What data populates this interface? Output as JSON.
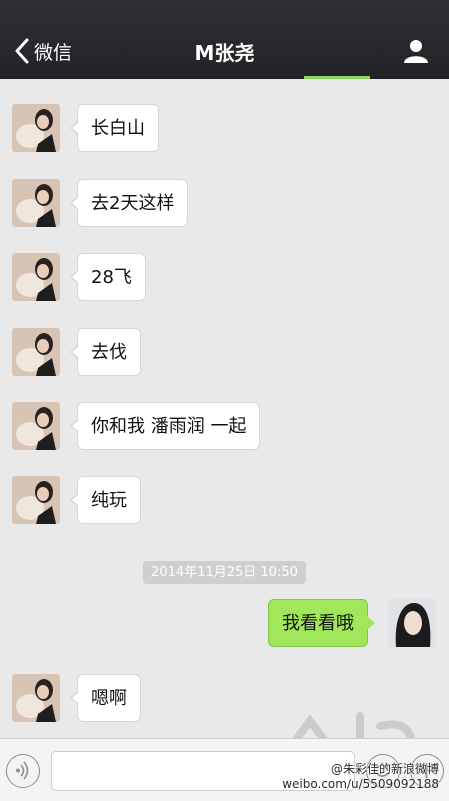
{
  "nav": {
    "back_label": "微信",
    "title": "M张尧"
  },
  "messages": [
    {
      "side": "in",
      "text": "长白山"
    },
    {
      "side": "in",
      "text": "去2天这样"
    },
    {
      "side": "in",
      "text": "28飞"
    },
    {
      "side": "in",
      "text": "去伐"
    },
    {
      "side": "in",
      "text": "你和我 潘雨润 一起"
    },
    {
      "side": "in",
      "text": "纯玩"
    },
    {
      "side": "out",
      "text": "我看看哦"
    },
    {
      "side": "in",
      "text": "嗯啊"
    }
  ],
  "timestamp": "2014年11月25日 10:50",
  "input": {
    "value": ""
  },
  "watermark": {
    "line1": "@朱彩佳的新浪微博",
    "line2": "weibo.com/u/5509092188"
  },
  "colors": {
    "nav_bg": "#2a2b2f",
    "chat_bg": "#e9e9e9",
    "outgoing_bubble": "#a0e75a",
    "incoming_bubble": "#ffffff"
  }
}
